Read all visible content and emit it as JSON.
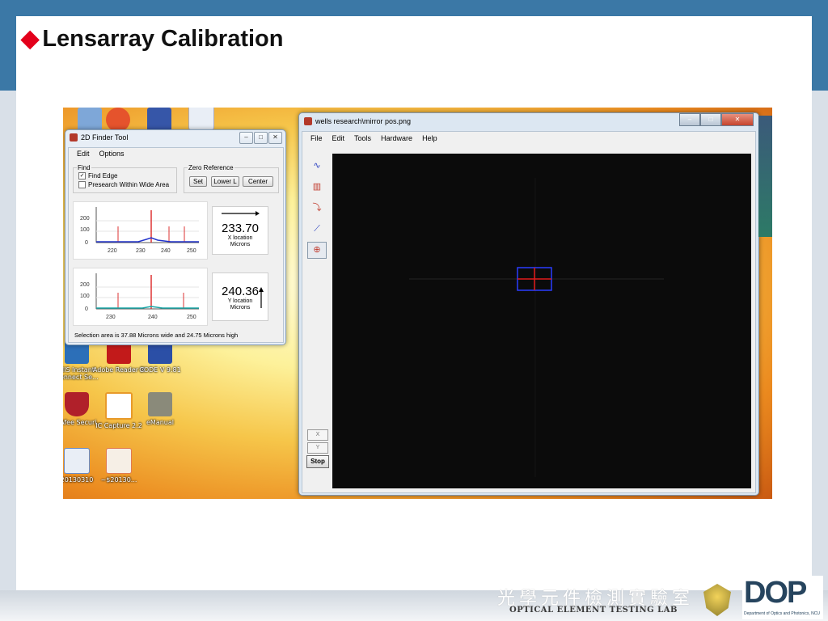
{
  "slide": {
    "title_marker": "◆",
    "title": "Lensarray Calibration"
  },
  "desktop": {
    "icons": [
      {
        "name": "",
        "color": "#4a7fc4"
      },
      {
        "name": "",
        "color": "#e5532c"
      },
      {
        "name": "",
        "color": "#3656a8"
      },
      {
        "name": "",
        "color": "#2a6bc0"
      },
      {
        "name": "NIS Instant Connect Se...",
        "color": "#2c6fb8"
      },
      {
        "name": "Adobe Reader X",
        "color": "#c21a1a"
      },
      {
        "name": "CODE V 9.81",
        "color": "#2b4fa6"
      },
      {
        "name": "McAfee Securi...",
        "color": "#b0202a"
      },
      {
        "name": "IC Capture 2.2",
        "color": "#e89a2a"
      },
      {
        "name": "eManual",
        "color": "#8a8a7a"
      },
      {
        "name": "20130310",
        "color": "#2a6bc0"
      },
      {
        "name": "~$20130...",
        "color": "#e07a50"
      }
    ]
  },
  "finder": {
    "title": "2D Finder Tool",
    "menu": [
      "Edit",
      "Options"
    ],
    "find_group": "Find",
    "find_edge_label": "Find Edge",
    "find_edge_checked": true,
    "presearch_label": "Presearch Within Wide Area",
    "presearch_checked": false,
    "zero_group": "Zero Reference",
    "zero_buttons": [
      "Set",
      "Lower L",
      "Center"
    ],
    "x_readout": {
      "value": "233.70",
      "label1": "X location",
      "label2": "Microns"
    },
    "y_readout": {
      "value": "240.36",
      "label1": "Y location",
      "label2": "Microns"
    },
    "status": "Selection area is 37.88 Microns wide and 24.75 Microns high",
    "x_chart": {
      "yticks": [
        "200",
        "100",
        "0"
      ],
      "xticks": [
        "220",
        "230",
        "240",
        "250"
      ]
    },
    "y_chart": {
      "yticks": [
        "200",
        "100",
        "0"
      ],
      "xticks": [
        "230",
        "240",
        "250"
      ]
    }
  },
  "viewer": {
    "title": "wells research\\mirror pos.png",
    "menu": [
      "File",
      "Edit",
      "Tools",
      "Hardware",
      "Help"
    ],
    "side_buttons": [
      "X",
      "Y"
    ],
    "stop_label": "Stop"
  },
  "footer": {
    "cjk": "光學元件檢測實驗室",
    "lab": "OPTICAL ELEMENT TESTING LAB",
    "logo": "DOP",
    "logo_sub": "Department of Optics and Photonics, NCU"
  },
  "colors": {
    "header_blue": "#3b78a6",
    "accent_red": "#e3001b",
    "crosshair_red": "#e21b1b",
    "selection_blue": "#2a3cff"
  }
}
